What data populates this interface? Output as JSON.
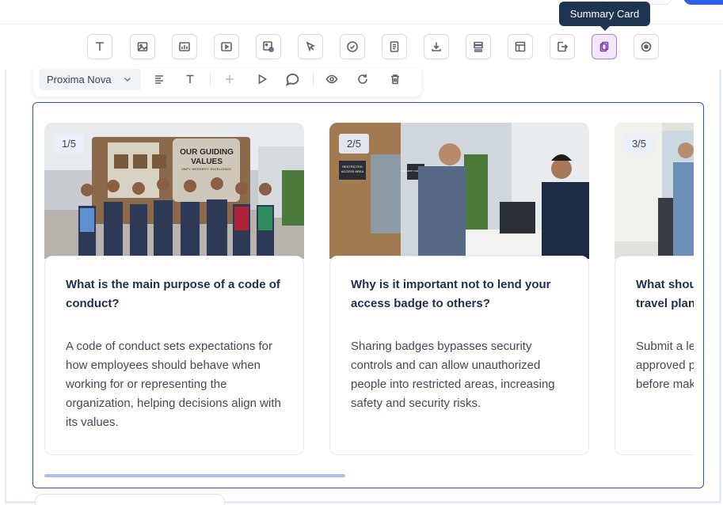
{
  "tooltip": {
    "label": "Summary Card"
  },
  "block_toolbar": {
    "buttons": [
      {
        "name": "text-block-button",
        "icon": "text-icon"
      },
      {
        "name": "image-block-button",
        "icon": "image-icon"
      },
      {
        "name": "chart-block-button",
        "icon": "chart-icon"
      },
      {
        "name": "video-block-button",
        "icon": "video-icon"
      },
      {
        "name": "image-hotspot-button",
        "icon": "image-plus-icon"
      },
      {
        "name": "interaction-button",
        "icon": "pointer-icon"
      },
      {
        "name": "check-button",
        "icon": "check-circle-icon"
      },
      {
        "name": "document-button",
        "icon": "document-icon"
      },
      {
        "name": "download-button",
        "icon": "download-icon"
      },
      {
        "name": "stack-button",
        "icon": "stack-icon"
      },
      {
        "name": "layout-button",
        "icon": "layout-icon"
      },
      {
        "name": "export-button",
        "icon": "export-icon"
      },
      {
        "name": "summary-card-button",
        "icon": "cards-icon",
        "active": true
      },
      {
        "name": "record-button",
        "icon": "radio-icon"
      }
    ]
  },
  "format_toolbar": {
    "font": "Proxima Nova"
  },
  "cards": [
    {
      "badge": "1/5",
      "question": "What is the main purpose of a code of conduct?",
      "answer": "A code of conduct sets expectations for how employees should behave when working for or representing the organization, helping decisions align with its values.",
      "image_sign": [
        "OUR GUIDING",
        "VALUES",
        "UNITY. INTEGRITY. EXCELLENCE."
      ]
    },
    {
      "badge": "2/5",
      "question": "Why is it important not to lend your access badge to others?",
      "answer": "Sharing badges bypasses security controls and can allow unauthorized people into restricted areas, increasing safety and security risks.",
      "image_sign": [
        "RESTRICTED",
        "ACCESS AREA",
        "SECURITY CHECKPOINT"
      ]
    },
    {
      "badge": "3/5",
      "question": "What should you do when confirming travel plans that require time off?",
      "answer": "Submit a leave request through the approved process and wait for approval before making arrangements."
    }
  ],
  "colors": {
    "accent": "#2f55b8",
    "active_button": "#f1e6fb",
    "tooltip": "#1d3550",
    "scrollbar": "#a9c0ef"
  }
}
